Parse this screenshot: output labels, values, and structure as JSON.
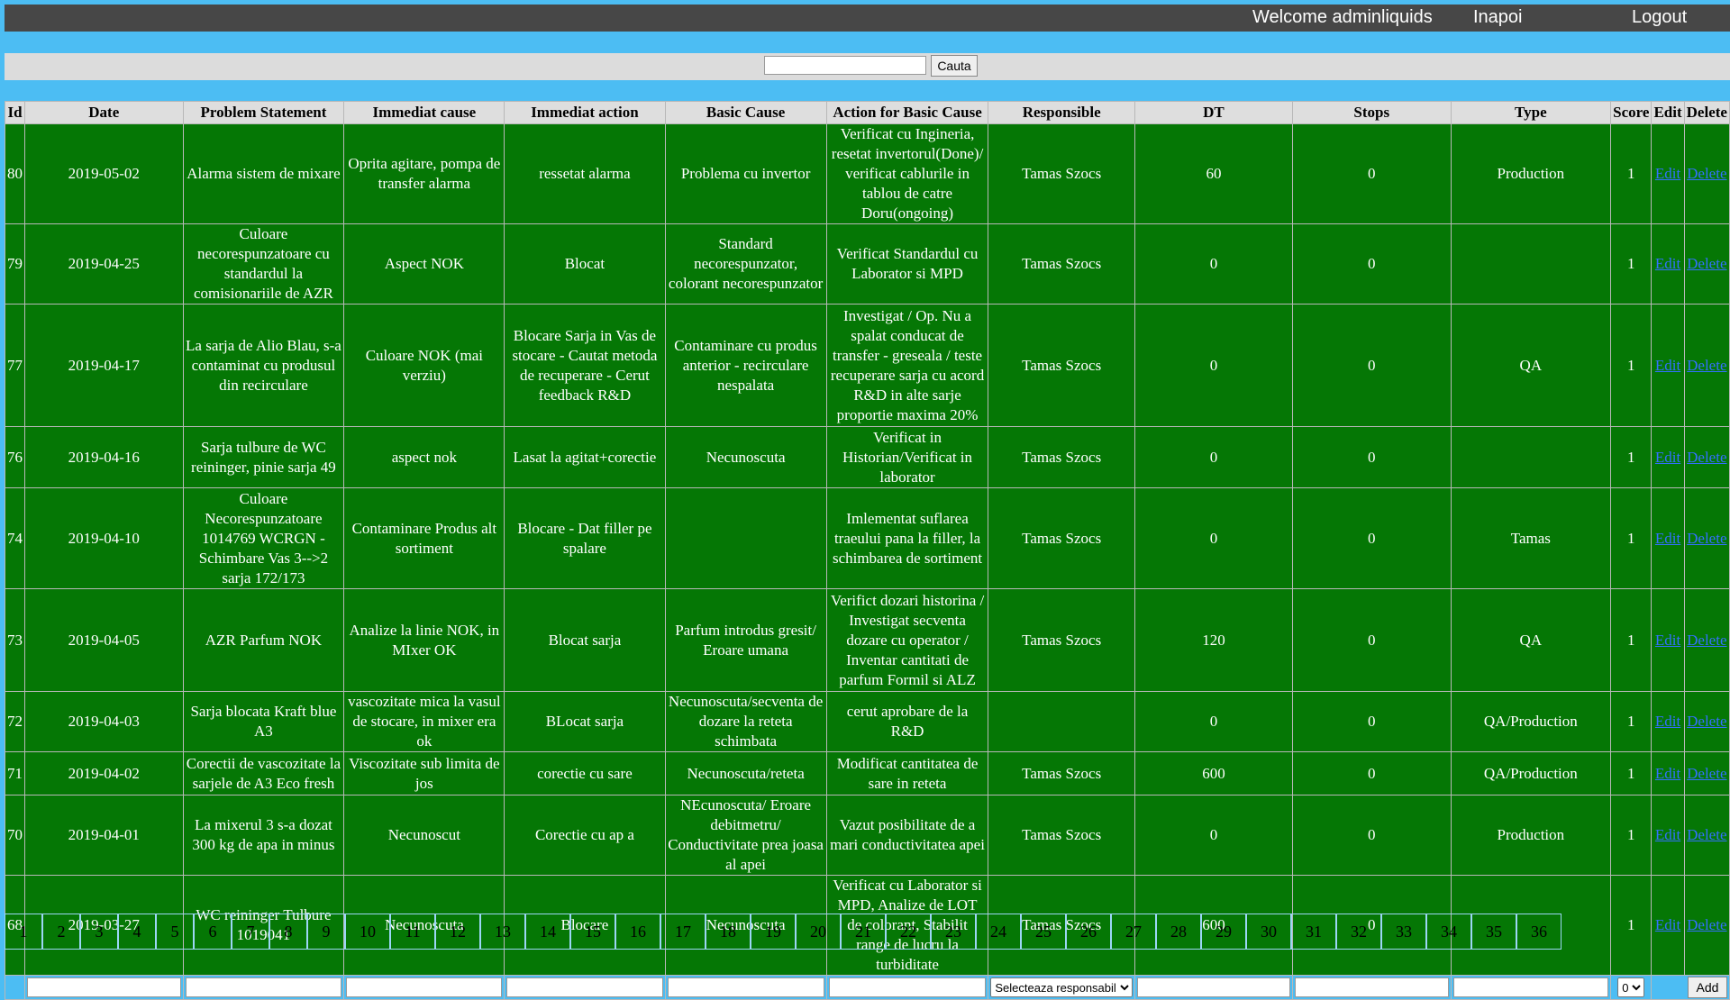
{
  "header": {
    "welcome": "Welcome adminliquids",
    "back": "Inapoi",
    "logout": "Logout"
  },
  "search": {
    "value": "",
    "button": "Cauta"
  },
  "table": {
    "columns": [
      "Id",
      "Date",
      "Problem Statement",
      "Immediat cause",
      "Immediat action",
      "Basic Cause",
      "Action for Basic Cause",
      "Responsible",
      "DT",
      "Stops",
      "Type",
      "Score",
      "Edit",
      "Delete"
    ],
    "edit_label": "Edit",
    "delete_label": "Delete",
    "rows": [
      {
        "id": "80",
        "date": "2019-05-02",
        "problem": "Alarma sistem de mixare",
        "cause": "Oprita agitare, pompa de transfer alarma",
        "action": "ressetat alarma",
        "basic": "Problema cu invertor",
        "basic_action": "Verificat cu Ingineria, resetat invertorul(Done)/ verificat cablurile in tablou de catre Doru(ongoing)",
        "responsible": "Tamas Szocs",
        "dt": "60",
        "stops": "0",
        "type": "Production",
        "score": "1"
      },
      {
        "id": "79",
        "date": "2019-04-25",
        "problem": "Culoare necorespunzatoare cu standardul la comisionariile de AZR",
        "cause": "Aspect NOK",
        "action": "Blocat",
        "basic": "Standard necorespunzator, colorant necorespunzator",
        "basic_action": "Verificat Standardul cu Laborator si MPD",
        "responsible": "Tamas Szocs",
        "dt": "0",
        "stops": "0",
        "type": "",
        "score": "1"
      },
      {
        "id": "77",
        "date": "2019-04-17",
        "problem": "La sarja de Alio Blau, s-a contaminat cu produsul din recirculare",
        "cause": "Culoare NOK (mai verziu)",
        "action": "Blocare Sarja in Vas de stocare - Cautat metoda de recuperare - Cerut feedback R&D",
        "basic": "Contaminare cu produs anterior - recirculare nespalata",
        "basic_action": "Investigat / Op. Nu a spalat conducat de transfer - greseala / teste recuperare sarja cu acord R&D in alte sarje proportie maxima 20%",
        "responsible": "Tamas Szocs",
        "dt": "0",
        "stops": "0",
        "type": "QA",
        "score": "1"
      },
      {
        "id": "76",
        "date": "2019-04-16",
        "problem": "Sarja tulbure de WC reininger, pinie sarja 49",
        "cause": "aspect nok",
        "action": "Lasat la agitat+corectie",
        "basic": "Necunoscuta",
        "basic_action": "Verificat in Historian/Verificat in laborator",
        "responsible": "Tamas Szocs",
        "dt": "0",
        "stops": "0",
        "type": "",
        "score": "1"
      },
      {
        "id": "74",
        "date": "2019-04-10",
        "problem": "Culoare Necorespunzatoare 1014769 WCRGN - Schimbare Vas 3-->2 sarja 172/173",
        "cause": "Contaminare Produs alt sortiment",
        "action": "Blocare - Dat filler pe spalare",
        "basic": "",
        "basic_action": "Imlementat suflarea traeului pana la filler, la schimbarea de sortiment",
        "responsible": "Tamas Szocs",
        "dt": "0",
        "stops": "0",
        "type": "Tamas",
        "score": "1"
      },
      {
        "id": "73",
        "date": "2019-04-05",
        "problem": "AZR Parfum NOK",
        "cause": "Analize la linie NOK, in MIxer OK",
        "action": "Blocat sarja",
        "basic": "Parfum introdus gresit/ Eroare umana",
        "basic_action": "Verifict dozari historina / Investigat secventa dozare cu operator / Inventar cantitati de parfum Formil si ALZ",
        "responsible": "Tamas Szocs",
        "dt": "120",
        "stops": "0",
        "type": "QA",
        "score": "1"
      },
      {
        "id": "72",
        "date": "2019-04-03",
        "problem": "Sarja blocata Kraft blue A3",
        "cause": "vascozitate mica la vasul de stocare, in mixer era ok",
        "action": "BLocat sarja",
        "basic": "Necunoscuta/secventa de dozare la reteta schimbata",
        "basic_action": "cerut aprobare de la R&D",
        "responsible": "",
        "dt": "0",
        "stops": "0",
        "type": "QA/Production",
        "score": "1"
      },
      {
        "id": "71",
        "date": "2019-04-02",
        "problem": "Corectii de vascozitate la sarjele de A3 Eco fresh",
        "cause": "Viscozitate sub limita de jos",
        "action": "corectie cu sare",
        "basic": "Necunoscuta/reteta",
        "basic_action": "Modificat cantitatea de sare in reteta",
        "responsible": "Tamas Szocs",
        "dt": "600",
        "stops": "0",
        "type": "QA/Production",
        "score": "1"
      },
      {
        "id": "70",
        "date": "2019-04-01",
        "problem": "La mixerul 3 s-a dozat 300 kg de apa in minus",
        "cause": "Necunoscut",
        "action": "Corectie cu ap a",
        "basic": "NEcunoscuta/ Eroare debitmetru/ Conductivitate prea joasa al apei",
        "basic_action": "Vazut posibilitate de a mari conductivitatea apei",
        "responsible": "Tamas Szocs",
        "dt": "0",
        "stops": "0",
        "type": "Production",
        "score": "1"
      },
      {
        "id": "68",
        "date": "2019-03-27",
        "problem": "WC reininger Tulbure 1019041",
        "cause": "Necunoscuta",
        "action": "Blocare",
        "basic": "Necunoscuta",
        "basic_action": "Verificat cu Laborator si MPD, Analize de LOT de colorant, Stabilit range de lucru la turbiditate",
        "responsible": "Tamas Szocs",
        "dt": "600",
        "stops": "0",
        "type": "",
        "score": "1"
      }
    ]
  },
  "add_form": {
    "responsible_placeholder": "Selecteaza responsabil",
    "score_value": "0",
    "add_button": "Add"
  },
  "pagination": [
    "1",
    "2",
    "3",
    "4",
    "5",
    "6",
    "7",
    "8",
    "9",
    "10",
    "11",
    "12",
    "13",
    "14",
    "15",
    "16",
    "17",
    "18",
    "19",
    "20",
    "21",
    "22",
    "23",
    "24",
    "25",
    "26",
    "27",
    "28",
    "29",
    "30",
    "31",
    "32",
    "33",
    "34",
    "35",
    "36"
  ]
}
